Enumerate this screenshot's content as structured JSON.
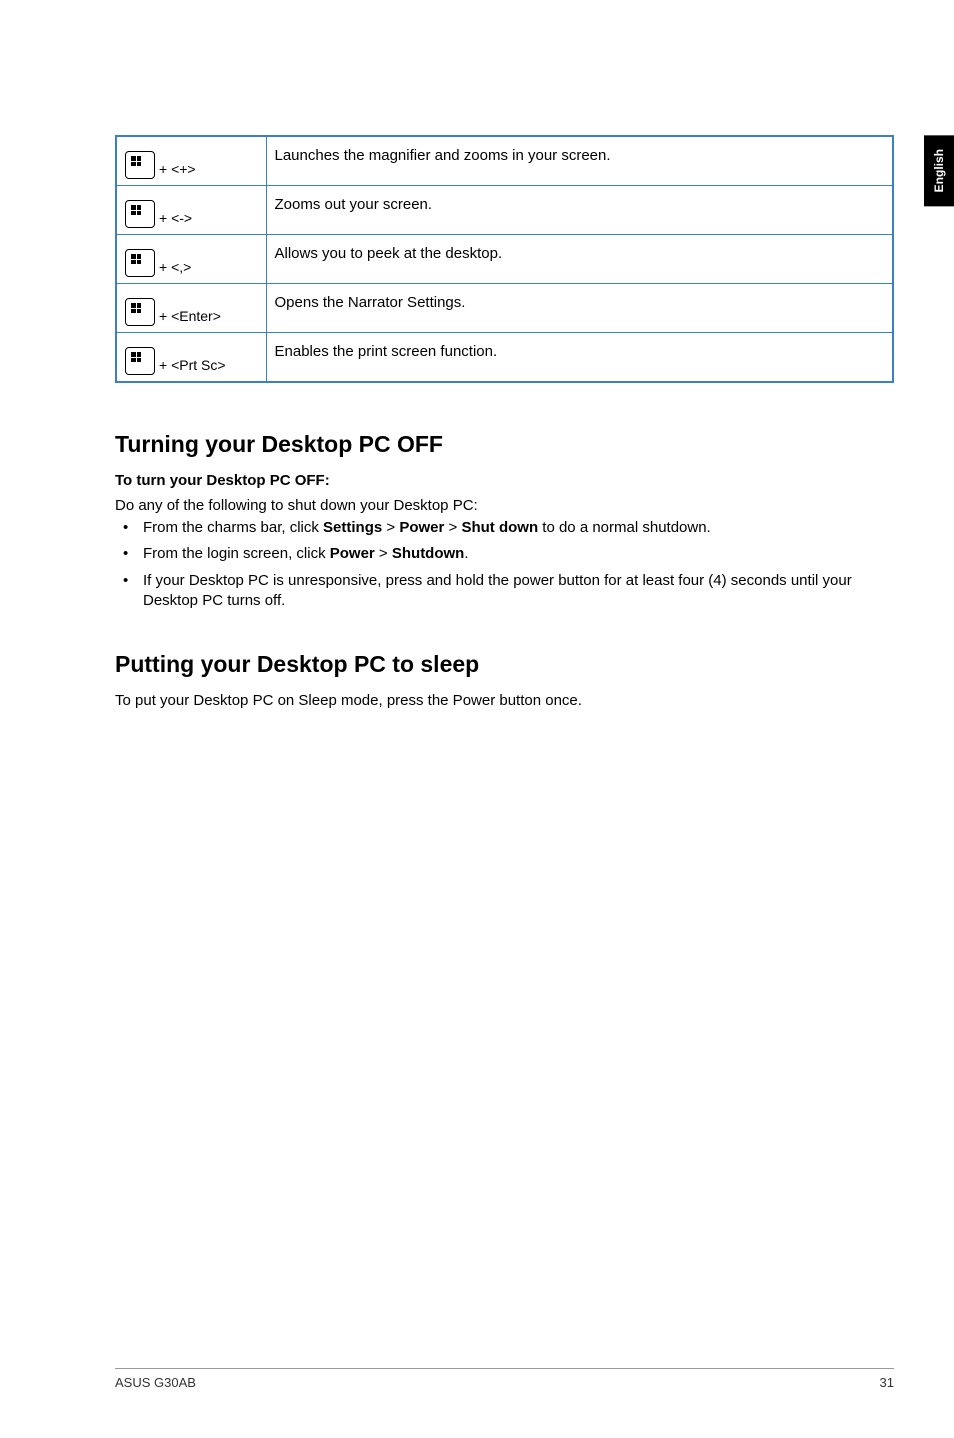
{
  "side_tab": "English",
  "shortcuts": [
    {
      "key_suffix": "+ <+>",
      "desc": "Launches the magnifier and zooms in your screen."
    },
    {
      "key_suffix": "+ <->",
      "desc": "Zooms out your screen."
    },
    {
      "key_suffix": "+ <,>",
      "desc": "Allows you to peek at the desktop."
    },
    {
      "key_suffix": "+ <Enter>",
      "desc": "Opens the Narrator Settings."
    },
    {
      "key_suffix": "+ <Prt Sc>",
      "desc": "Enables the print screen function."
    }
  ],
  "sections": {
    "off": {
      "heading": "Turning your Desktop PC OFF",
      "subhead": "To turn your Desktop PC OFF:",
      "intro": "Do any of the following to shut down your Desktop PC:",
      "items": [
        {
          "prefix": "From the charms bar, click ",
          "b1": "Settings",
          "sep1": " > ",
          "b2": "Power",
          "sep2": " > ",
          "b3": "Shut down",
          "suffix": " to do a normal shutdown."
        },
        {
          "prefix": "From the login screen, click ",
          "b1": "Power",
          "sep1": " > ",
          "b2": "Shutdown",
          "sep2": "",
          "b3": "",
          "suffix": "."
        },
        {
          "prefix": "If your Desktop PC is unresponsive, press and hold the power  button for at least four (4) seconds until your Desktop PC turns off.",
          "b1": "",
          "sep1": "",
          "b2": "",
          "sep2": "",
          "b3": "",
          "suffix": ""
        }
      ]
    },
    "sleep": {
      "heading": "Putting your Desktop PC to sleep",
      "body": "To put your Desktop PC on Sleep mode, press the Power button once."
    }
  },
  "footer": {
    "left": "ASUS G30AB",
    "right": "31"
  }
}
